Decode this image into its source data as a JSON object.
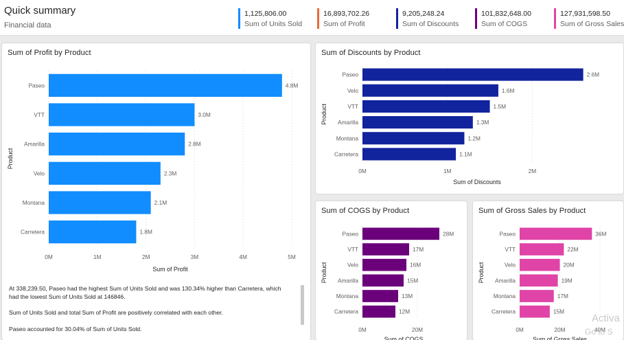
{
  "header": {
    "title": "Quick summary",
    "subtitle": "Financial data"
  },
  "kpis": [
    {
      "value": "1,125,806.00",
      "label": "Sum of Units Sold",
      "color": "#118dff"
    },
    {
      "value": "16,893,702.26",
      "label": "Sum of Profit",
      "color": "#e66c37"
    },
    {
      "value": "9,205,248.24",
      "label": "Sum of Discounts",
      "color": "#12239e"
    },
    {
      "value": "101,832,648.00",
      "label": "Sum of COGS",
      "color": "#6b007b"
    },
    {
      "value": "127,931,598.50",
      "label": "Sum of Gross Sales",
      "color": "#e044a7"
    }
  ],
  "narrative": [
    "At 338,239.50, Paseo had the highest Sum of Units Sold and was 130.34% higher than Carretera, which had the lowest Sum of Units Sold at 146846.",
    "Sum of Units Sold and total Sum of Profit are positively correlated with each other.",
    "Paseo accounted for 30.04% of Sum of Units Sold."
  ],
  "watermark": {
    "line1": "Activa",
    "line2": "Go to S"
  },
  "chart_data": [
    {
      "id": "profit",
      "type": "bar",
      "orientation": "horizontal",
      "title": "Sum of Profit by Product",
      "xlabel": "Sum of Profit",
      "ylabel": "Product",
      "color": "#118dff",
      "categories": [
        "Paseo",
        "VTT",
        "Amarilla",
        "Velo",
        "Montana",
        "Carretera"
      ],
      "values": [
        4.8,
        3.0,
        2.8,
        2.3,
        2.1,
        1.8
      ],
      "labels": [
        "4.8M",
        "3.0M",
        "2.8M",
        "2.3M",
        "2.1M",
        "1.8M"
      ],
      "xticks": [
        "0M",
        "1M",
        "2M",
        "3M",
        "4M",
        "5M"
      ],
      "xlim": [
        0,
        5
      ],
      "grid": true
    },
    {
      "id": "discounts",
      "type": "bar",
      "orientation": "horizontal",
      "title": "Sum of Discounts by Product",
      "xlabel": "Sum of Discounts",
      "ylabel": "Product",
      "color": "#12239e",
      "categories": [
        "Paseo",
        "Velo",
        "VTT",
        "Amarilla",
        "Montana",
        "Carretera"
      ],
      "values": [
        2.6,
        1.6,
        1.5,
        1.3,
        1.2,
        1.1
      ],
      "labels": [
        "2.6M",
        "1.6M",
        "1.5M",
        "1.3M",
        "1.2M",
        "1.1M"
      ],
      "xticks": [
        "0M",
        "1M",
        "2M"
      ],
      "xlim": [
        0,
        2.7
      ],
      "grid": true
    },
    {
      "id": "cogs",
      "type": "bar",
      "orientation": "horizontal",
      "title": "Sum of COGS by Product",
      "xlabel": "Sum of COGS",
      "ylabel": "Product",
      "color": "#6b007b",
      "categories": [
        "Paseo",
        "VTT",
        "Velo",
        "Amarilla",
        "Montana",
        "Carretera"
      ],
      "values": [
        28,
        17,
        16,
        15,
        13,
        12
      ],
      "labels": [
        "28M",
        "17M",
        "16M",
        "15M",
        "13M",
        "12M"
      ],
      "xticks": [
        "0M",
        "20M"
      ],
      "xlim": [
        0,
        30
      ],
      "grid": true
    },
    {
      "id": "gross",
      "type": "bar",
      "orientation": "horizontal",
      "title": "Sum of Gross Sales by Product",
      "xlabel": "Sum of Gross Sales",
      "ylabel": "Product",
      "color": "#e044a7",
      "categories": [
        "Paseo",
        "VTT",
        "Velo",
        "Amarilla",
        "Montana",
        "Carretera"
      ],
      "values": [
        36,
        22,
        20,
        19,
        17,
        15
      ],
      "labels": [
        "36M",
        "22M",
        "20M",
        "19M",
        "17M",
        "15M"
      ],
      "xticks": [
        "0M",
        "20M",
        "40M"
      ],
      "xlim": [
        0,
        40
      ],
      "grid": true
    }
  ]
}
